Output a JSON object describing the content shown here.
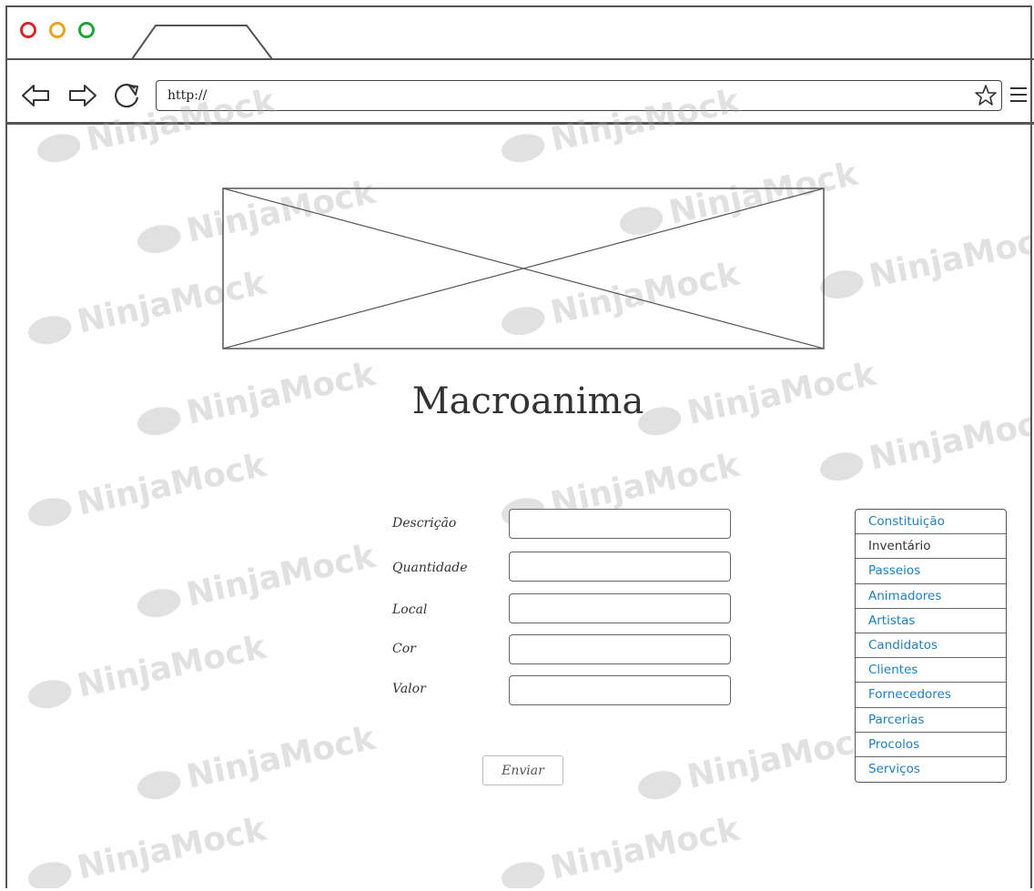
{
  "browser": {
    "url_value": "http://",
    "tab_label": ""
  },
  "watermark": {
    "text": "NinjaMock"
  },
  "page": {
    "title": "Macroanima"
  },
  "form": {
    "fields": [
      {
        "label": "Descrição",
        "value": ""
      },
      {
        "label": "Quantidade",
        "value": ""
      },
      {
        "label": "Local",
        "value": ""
      },
      {
        "label": "Cor",
        "value": ""
      },
      {
        "label": "Valor",
        "value": ""
      }
    ],
    "submit_label": "Enviar"
  },
  "side_menu": {
    "items": [
      {
        "label": "Constituição",
        "link": true
      },
      {
        "label": "Inventário",
        "link": false
      },
      {
        "label": "Passeios",
        "link": true
      },
      {
        "label": "Animadores",
        "link": true
      },
      {
        "label": "Artistas",
        "link": true
      },
      {
        "label": "Candidatos",
        "link": true
      },
      {
        "label": "Clientes",
        "link": true
      },
      {
        "label": "Fornecedores",
        "link": true
      },
      {
        "label": "Parcerias",
        "link": true
      },
      {
        "label": "Procolos",
        "link": true
      },
      {
        "label": "Serviços",
        "link": true
      }
    ]
  },
  "colors": {
    "link": "#1e7fc3",
    "close_dot": "#d9262b",
    "minimize_dot": "#e8a317",
    "maximize_dot": "#1fa535"
  },
  "icons": [
    "close-dot-icon",
    "minimize-dot-icon",
    "maximize-dot-icon",
    "back-arrow-icon",
    "forward-arrow-icon",
    "reload-icon",
    "star-icon",
    "hamburger-menu-icon"
  ]
}
